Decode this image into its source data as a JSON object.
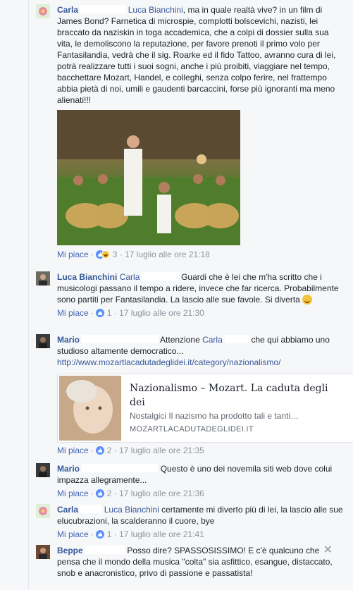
{
  "comments": [
    {
      "author": "Carla",
      "tag": "Luca Bianchini",
      "text": ", ma in quale realtà vive? in un film di James Bond? Farnetica di microspie, complotti bolscevichi, nazisti, lei braccato da naziskin in toga accademica, che a colpi di dossier sulla sua vita, le demoliscono la reputazione, per favore prenoti il primo volo per Fantasilandia, vedrà che il sig. Roarke ed il fido Tattoo, avranno cura di lei, potrà realizzare tutti i suoi sogni, anche i più proibiti, viaggiare nel tempo, bacchettare Mozart, Handel, e colleghi, senza colpo ferire, nel frattempo abbia pietà di noi, umili e gaudenti barcaccini, forse più ignoranti ma meno alienati!!!",
      "like_label": "Mi piace",
      "reactions": "3",
      "timestamp": "17 luglio alle ore 21:18"
    },
    {
      "author": "Luca Bianchini",
      "tag": "Carla",
      "text": "Guardi che è lei che m'ha scritto che i musicologi passano il tempo a ridere, invece che far ricerca. Probabilmente sono partiti per Fantasilandia. La lascio alle sue favole. Si diverta",
      "like_label": "Mi piace",
      "reactions": "1",
      "timestamp": "17 luglio alle ore 21:30"
    },
    {
      "author": "Mario",
      "text_before": "Attenzione",
      "tag": "Carla",
      "text_after": "che qui abbiamo uno studioso altamente democratico...",
      "url": "http://www.mozartlacadutadeglidei.it/category/nazionalismo/",
      "card": {
        "title": "Nazionalismo – Mozart. La caduta degli dei",
        "description": "Nostalgici Il nazismo ha prodotto tali e tanti…",
        "domain": "MOZARTLACADUTADEGLIDEI.IT"
      },
      "like_label": "Mi piace",
      "reactions": "2",
      "timestamp": "17 luglio alle ore 21:35"
    },
    {
      "author": "Mario",
      "text": "Questo è uno dei novemila siti web dove colui impazza allegramente...",
      "like_label": "Mi piace",
      "reactions": "2",
      "timestamp": "17 luglio alle ore 21:36"
    },
    {
      "author": "Carla",
      "tag": "Luca Bianchini",
      "text": "certamente mi diverto più di lei, la lascio alle sue elucubrazioni, la scalderanno il cuore, bye",
      "like_label": "Mi piace",
      "reactions": "1",
      "timestamp": "17 luglio alle ore 21:41"
    },
    {
      "author": "Beppe",
      "text": "Posso dire? SPASSOSISSIMO! E c'è qualcuno che pensa che il mondo della musica \"colta\" sia asfittico, esangue, distaccato, snob e anacronistico, privo di passione e passatista!"
    }
  ],
  "separator": "·",
  "colors": {
    "link": "#365899",
    "meta": "#90949c",
    "like_blue": "#5890ff"
  },
  "icons": [
    "like-reaction-icon",
    "haha-reaction-icon",
    "smiley-emoji-icon",
    "close-icon"
  ]
}
